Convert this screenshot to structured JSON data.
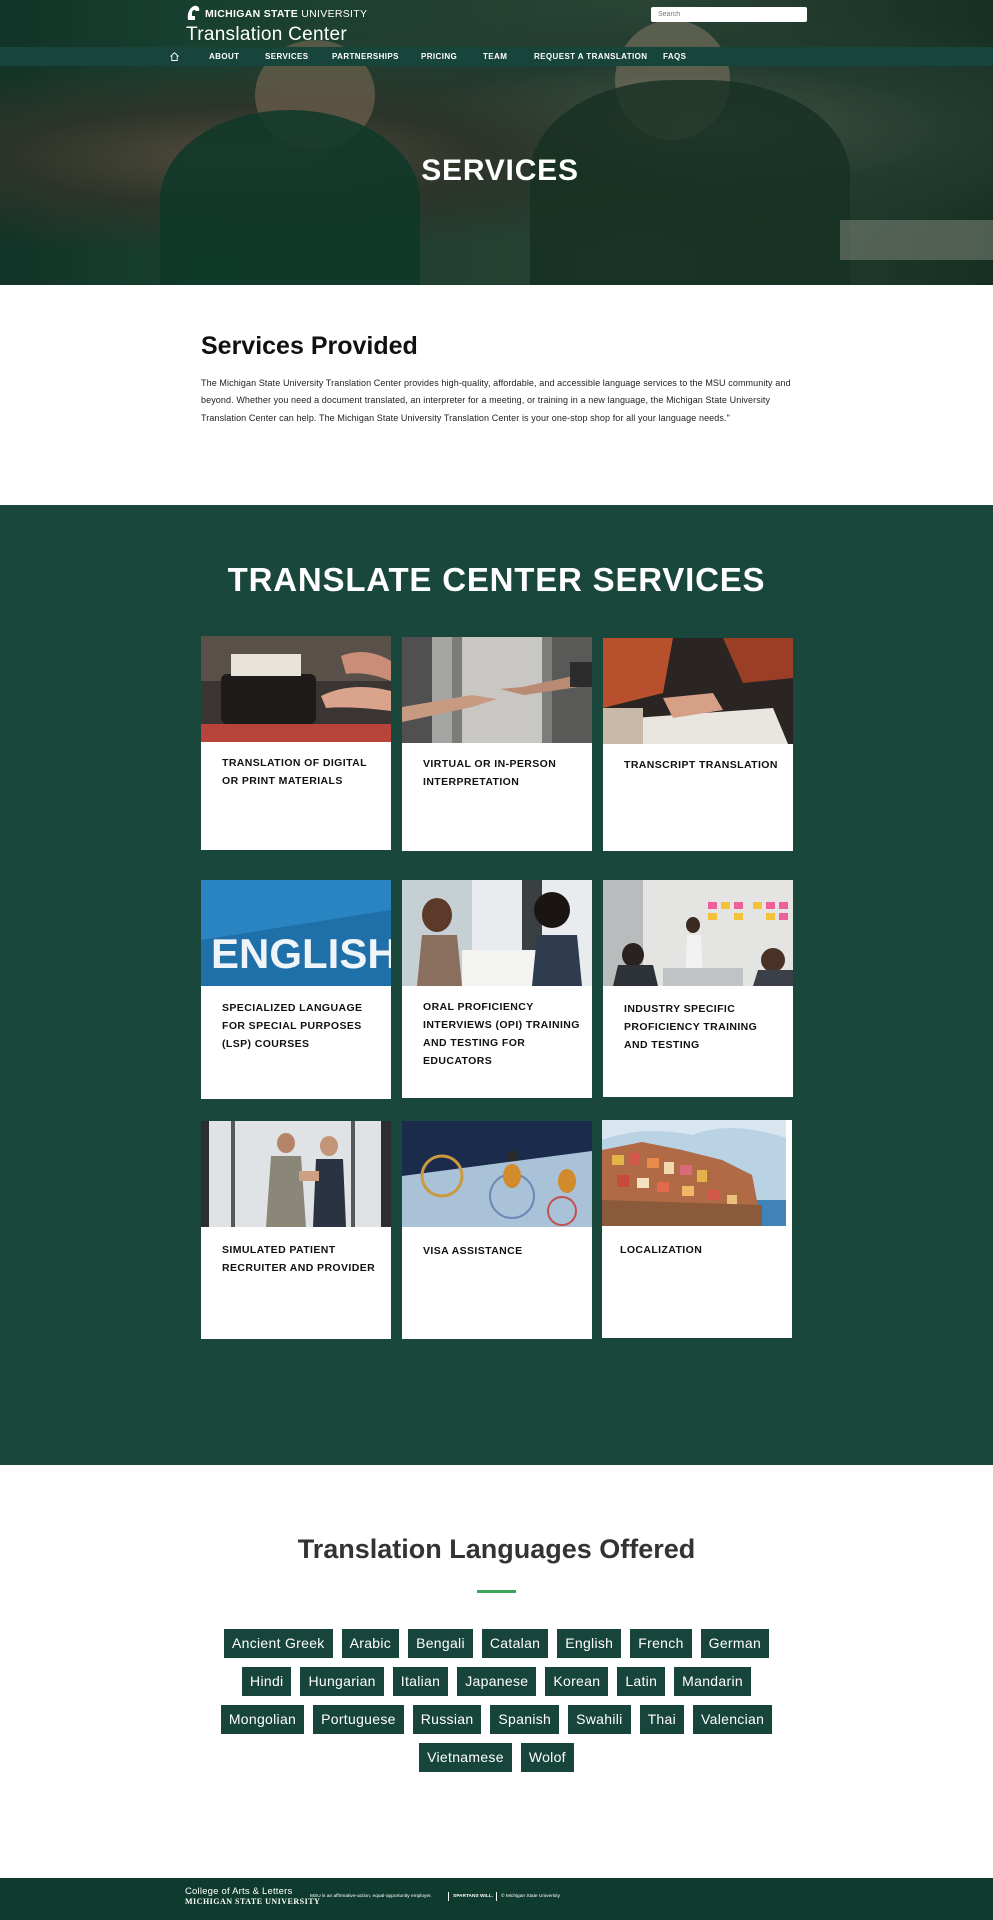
{
  "header": {
    "university_bold": "MICHIGAN STATE",
    "university_light": "UNIVERSITY",
    "site_title": "Translation Center",
    "search_placeholder": "Search"
  },
  "nav": {
    "items": [
      "ABOUT",
      "SERVICES",
      "PARTNERSHIPS",
      "PRICING",
      "TEAM",
      "REQUEST A TRANSLATION",
      "FAQS"
    ]
  },
  "hero": {
    "title": "SERVICES"
  },
  "services_provided": {
    "heading": "Services Provided",
    "body": "The Michigan State University Translation Center provides high-quality, affordable, and accessible language services to the MSU community and beyond. Whether you need a document translated, an interpreter for a meeting, or training in a new language, the Michigan State University Translation Center can help. The Michigan State University Translation Center is your one-stop shop for all your language needs.\""
  },
  "translate_services": {
    "heading": "TRANSLATE CENTER SERVICES",
    "cards": [
      {
        "label": "TRANSLATION OF DIGITAL OR PRINT MATERIALS",
        "image": "typewriter-photo"
      },
      {
        "label": "VIRTUAL OR IN-PERSON INTERPRETATION",
        "image": "hands-reaching-photo"
      },
      {
        "label": "TRANSCRIPT TRANSLATION",
        "image": "signing-document-photo"
      },
      {
        "label": "SPECIALIZED LANGUAGE FOR SPECIAL PURPOSES (LSP) COURSES",
        "image": "english-sign-photo",
        "image_text": "ENGLISH"
      },
      {
        "label": "ORAL PROFICIENCY INTERVIEWS (OPI) TRAINING AND TESTING FOR EDUCATORS",
        "image": "interview-photo"
      },
      {
        "label": "INDUSTRY SPECIFIC PROFICIENCY TRAINING AND TESTING",
        "image": "office-meeting-photo"
      },
      {
        "label": "SIMULATED PATIENT RECRUITER AND PROVIDER",
        "image": "handshake-photo"
      },
      {
        "label": "VISA ASSISTANCE",
        "image": "passport-photo"
      },
      {
        "label": "LOCALIZATION",
        "image": "cliff-village-photo"
      }
    ]
  },
  "languages": {
    "heading": "Translation Languages Offered",
    "rows": [
      [
        "Ancient Greek",
        "Arabic",
        "Bengali",
        "Catalan",
        "English",
        "French",
        "German"
      ],
      [
        "Hindi",
        "Hungarian",
        "Italian",
        "Japanese",
        "Korean",
        "Latin",
        "Mandarin"
      ],
      [
        "Mongolian",
        "Portuguese",
        "Russian",
        "Spanish",
        "Swahili",
        "Thai",
        "Valencian"
      ],
      [
        "Vietnamese",
        "Wolof"
      ]
    ]
  },
  "footer": {
    "college": "College of Arts & Letters",
    "university": "MICHIGAN STATE UNIVERSITY",
    "eeo": "MSU is an affirmative-action, equal-opportunity employer.",
    "spartans": "SPARTANS WILL.",
    "copyright": "© Michigan State University"
  },
  "colors": {
    "msu_green": "#18453b",
    "section_green": "#1a473b",
    "accent_underline": "#3ba55c",
    "footer_green": "#0e3b2e"
  }
}
